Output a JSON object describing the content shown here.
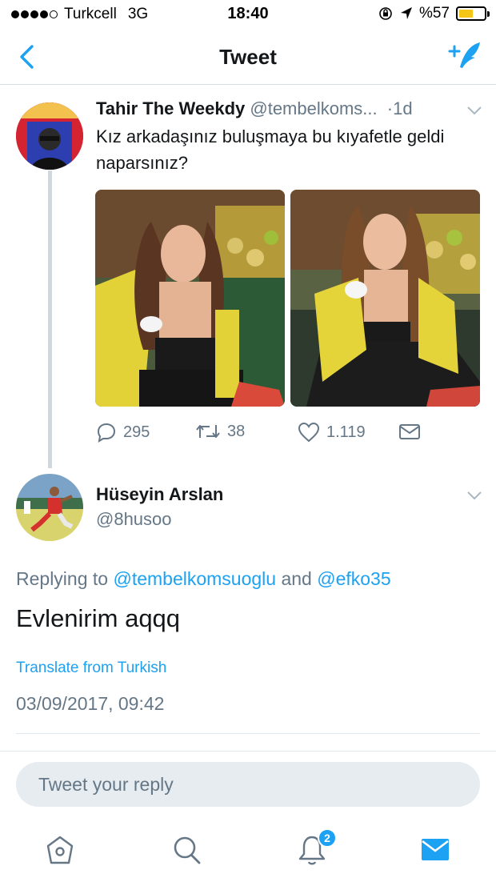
{
  "status_bar": {
    "carrier": "Turkcell",
    "network": "3G",
    "time": "18:40",
    "battery": "%57",
    "battery_level": 0.57,
    "icons": [
      "orientation-lock-icon",
      "location-icon",
      "battery-icon"
    ]
  },
  "nav": {
    "title": "Tweet",
    "back_icon": "back-chevron-icon",
    "compose_icon": "compose-tweet-icon"
  },
  "tweet": {
    "author_name": "Tahir The Weekdy",
    "author_handle": "@tembelkoms...",
    "separator": "·",
    "age": "1d",
    "text": "Kız arkadaşınız buluşmaya bu kıyafetle geldi naparsınız?",
    "replies": "295",
    "retweets": "38",
    "likes": "1.119"
  },
  "reply": {
    "author_name": "Hüseyin Arslan",
    "author_handle": "@8husoo",
    "replying_prefix": "Replying to",
    "mention_1": "@tembelkomsuoglu",
    "conjunction": "and",
    "mention_2": "@efko35",
    "text": "Evlenirim aqqq",
    "translate": "Translate from Turkish",
    "timestamp": "03/09/2017, 09:42"
  },
  "reply_box": {
    "placeholder": "Tweet your reply"
  },
  "tab_bar": {
    "items": [
      "home-icon",
      "search-icon",
      "notifications-icon",
      "messages-icon"
    ],
    "notification_count": "2"
  },
  "colors": {
    "accent": "#1da1f2",
    "muted": "#657786",
    "text": "#14171a",
    "battery": "#f5c518"
  }
}
